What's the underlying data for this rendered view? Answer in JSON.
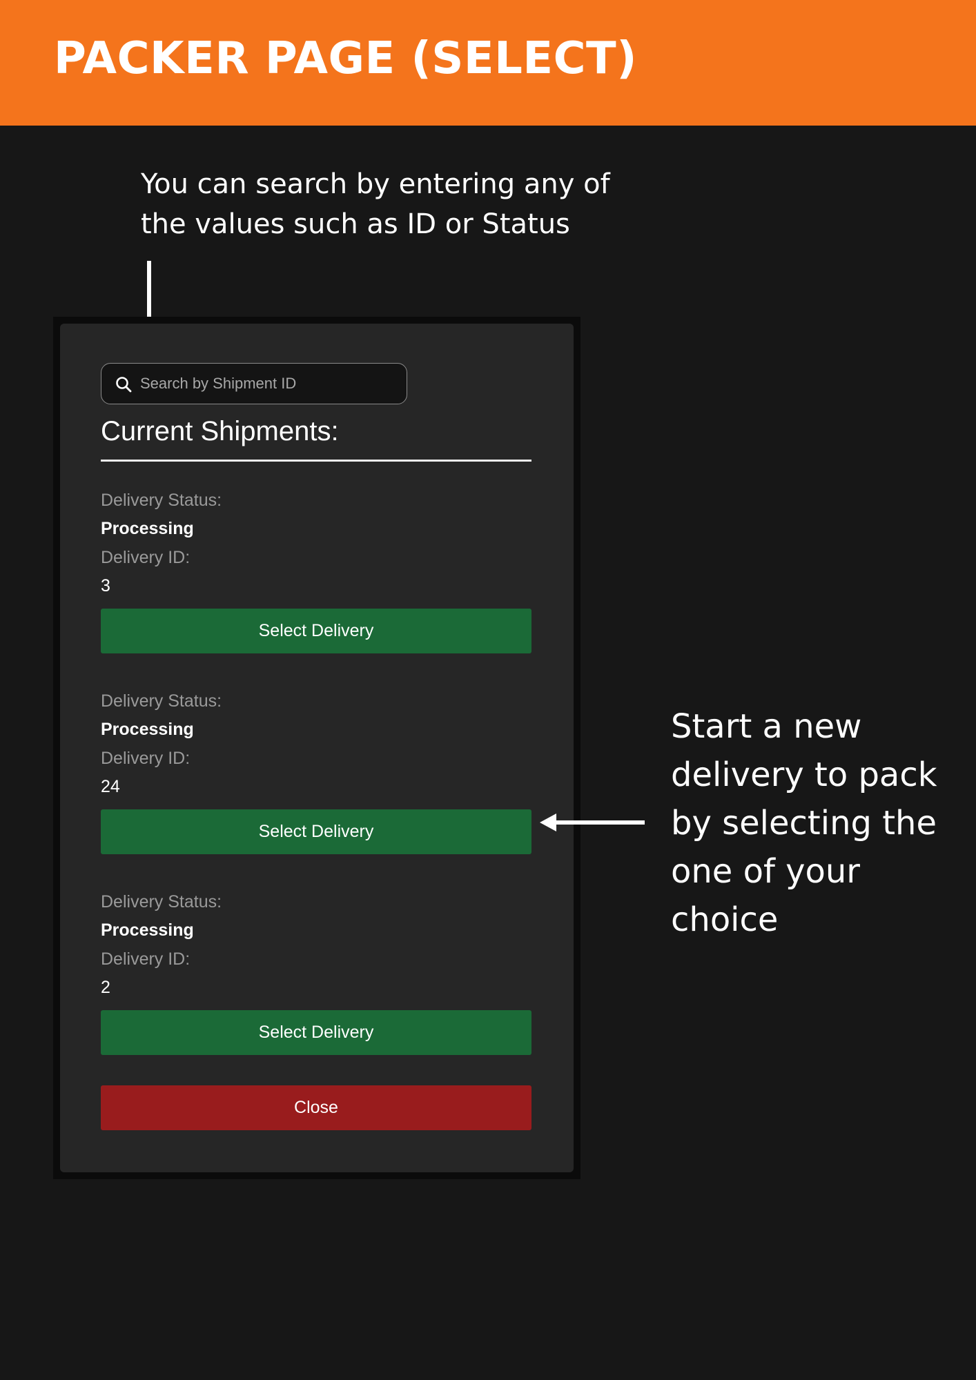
{
  "header": {
    "title": "PACKER PAGE (SELECT)"
  },
  "annotations": {
    "search_note": "You can search by entering any of the values such as ID or Status",
    "select_note": "Start a new delivery to pack by selecting the one of your choice"
  },
  "colors": {
    "header_bg": "#f4741c",
    "page_bg": "#171717",
    "panel_bg": "#262626",
    "select_button": "#1b6a37",
    "close_button": "#991c1d"
  },
  "panel": {
    "search": {
      "placeholder": "Search by Shipment ID",
      "value": "",
      "icon": "search-icon"
    },
    "title": "Current Shipments:",
    "status_label": "Delivery Status:",
    "id_label": "Delivery ID:",
    "shipments": [
      {
        "status": "Processing",
        "id": "3",
        "button_label": "Select Delivery"
      },
      {
        "status": "Processing",
        "id": "24",
        "button_label": "Select Delivery"
      },
      {
        "status": "Processing",
        "id": "2",
        "button_label": "Select Delivery"
      }
    ],
    "close_label": "Close"
  }
}
